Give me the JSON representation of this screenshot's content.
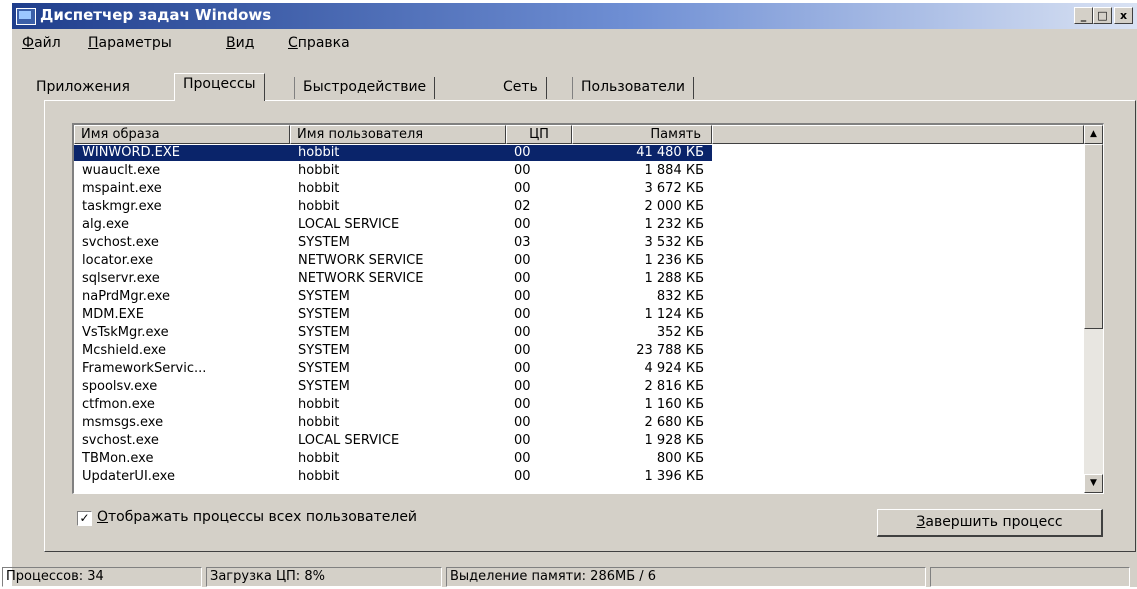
{
  "window": {
    "title": "Диспетчер задач Windows",
    "minimize": "_",
    "maximize": "□",
    "close": "x"
  },
  "menu": [
    {
      "label": "Файл",
      "u": "Ф",
      "rest": "айл"
    },
    {
      "label": "Параметры",
      "u": "П",
      "rest": "араметры"
    },
    {
      "label": "Вид",
      "u": "В",
      "rest": "ид"
    },
    {
      "label": "Справка",
      "u": "С",
      "rest": "правка"
    }
  ],
  "tabs": [
    "Приложения",
    "Процессы",
    "Быстродействие",
    "Сеть",
    "Пользователи"
  ],
  "active_tab": "Процессы",
  "columns": [
    "Имя образа",
    "Имя пользователя",
    "ЦП",
    "Память"
  ],
  "processes": [
    {
      "name": "WINWORD.EXE",
      "user": "hobbit",
      "cpu": "00",
      "mem": "41 480 КБ"
    },
    {
      "name": "wuauclt.exe",
      "user": "hobbit",
      "cpu": "00",
      "mem": "1 884 КБ"
    },
    {
      "name": "mspaint.exe",
      "user": "hobbit",
      "cpu": "00",
      "mem": "3 672 КБ"
    },
    {
      "name": "taskmgr.exe",
      "user": "hobbit",
      "cpu": "02",
      "mem": "2 000 КБ"
    },
    {
      "name": "alg.exe",
      "user": "LOCAL SERVICE",
      "cpu": "00",
      "mem": "1 232 КБ"
    },
    {
      "name": "svchost.exe",
      "user": "SYSTEM",
      "cpu": "03",
      "mem": "3 532 КБ"
    },
    {
      "name": "locator.exe",
      "user": "NETWORK SERVICE",
      "cpu": "00",
      "mem": "1 236 КБ"
    },
    {
      "name": "sqlservr.exe",
      "user": "NETWORK SERVICE",
      "cpu": "00",
      "mem": "1 288 КБ"
    },
    {
      "name": "naPrdMgr.exe",
      "user": "SYSTEM",
      "cpu": "00",
      "mem": "832 КБ"
    },
    {
      "name": "MDM.EXE",
      "user": "SYSTEM",
      "cpu": "00",
      "mem": "1 124 КБ"
    },
    {
      "name": "VsTskMgr.exe",
      "user": "SYSTEM",
      "cpu": "00",
      "mem": "352 КБ"
    },
    {
      "name": "Mcshield.exe",
      "user": "SYSTEM",
      "cpu": "00",
      "mem": "23 788 КБ"
    },
    {
      "name": "FrameworkServic...",
      "user": "SYSTEM",
      "cpu": "00",
      "mem": "4 924 КБ"
    },
    {
      "name": "spoolsv.exe",
      "user": "SYSTEM",
      "cpu": "00",
      "mem": "2 816 КБ"
    },
    {
      "name": "ctfmon.exe",
      "user": "hobbit",
      "cpu": "00",
      "mem": "1 160 КБ"
    },
    {
      "name": "msmsgs.exe",
      "user": "hobbit",
      "cpu": "00",
      "mem": "2 680 КБ"
    },
    {
      "name": "svchost.exe",
      "user": "LOCAL SERVICE",
      "cpu": "00",
      "mem": "1 928 КБ"
    },
    {
      "name": "TBMon.exe",
      "user": "hobbit",
      "cpu": "00",
      "mem": "800 КБ"
    },
    {
      "name": "UpdaterUI.exe",
      "user": "hobbit",
      "cpu": "00",
      "mem": "1 396 КБ"
    }
  ],
  "show_all_users": {
    "checked": true,
    "mark": "✓",
    "label": "Отображать процессы всех пользователей",
    "u": "О",
    "rest": "тображать процессы всех пользователей"
  },
  "end_process_button": {
    "label": "Завершить процесс",
    "u": "З",
    "rest": "авершить процесс"
  },
  "status": {
    "processes": "Процессов: 34",
    "cpu": "Загрузка ЦП: 8%",
    "memory": "Выделение памяти: 286МБ / 6"
  },
  "colors": {
    "selection": "#0a246a",
    "face": "#d4d0c8",
    "title_start": "#1f3e8c"
  }
}
